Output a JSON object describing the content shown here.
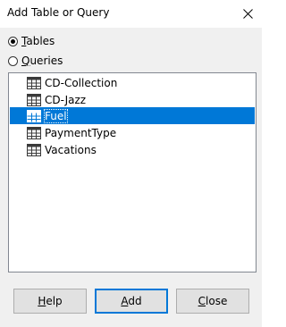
{
  "dialog": {
    "title": "Add Table or Query"
  },
  "options": {
    "tables": {
      "label_mnemonic": "T",
      "label_rest": "ables",
      "checked": true
    },
    "queries": {
      "label_mnemonic": "Q",
      "label_rest": "ueries",
      "checked": false
    }
  },
  "list": {
    "items": [
      {
        "label": "CD-Collection",
        "icon": "table-icon"
      },
      {
        "label": "CD-Jazz",
        "icon": "table-icon"
      },
      {
        "label": "Fuel",
        "icon": "table-icon",
        "selected": true
      },
      {
        "label": "PaymentType",
        "icon": "table-icon"
      },
      {
        "label": "Vacations",
        "icon": "table-icon"
      }
    ]
  },
  "buttons": {
    "help": {
      "mnemonic": "H",
      "rest": "elp"
    },
    "add": {
      "mnemonic": "A",
      "rest": "dd"
    },
    "close": {
      "mnemonic": "C",
      "rest": "lose"
    }
  },
  "colors": {
    "selection": "#0078d7",
    "dialog_bg": "#f0f0f0"
  }
}
